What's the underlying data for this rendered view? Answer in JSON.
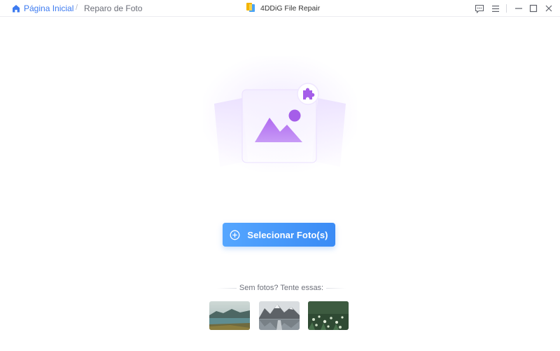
{
  "titlebar": {
    "home_label": "Página Inicial",
    "breadcrumb_separator": "/",
    "current_page": "Reparo de Foto",
    "app_title": "4DDiG File Repair",
    "icons": {
      "home": "home-icon",
      "logo": "app-logo-icon",
      "feedback": "feedback-icon",
      "menu": "menu-icon",
      "minimize": "minimize-icon",
      "maximize": "maximize-icon",
      "close": "close-icon"
    }
  },
  "main": {
    "illustration": "photo-placeholder-icon",
    "select_button": {
      "label": "Selecionar Foto(s)",
      "icon": "add-circle-icon"
    },
    "samples": {
      "heading": "Sem fotos? Tente essas:",
      "items": [
        {
          "icon": "lake-sample-thumbnail"
        },
        {
          "icon": "mountain-sample-thumbnail"
        },
        {
          "icon": "meadow-sample-thumbnail"
        }
      ]
    }
  },
  "colors": {
    "accent": "#3d7bf0",
    "button_start": "#55a6ff",
    "button_end": "#3a8bf5",
    "illustration_purple": "#a15ee8"
  }
}
